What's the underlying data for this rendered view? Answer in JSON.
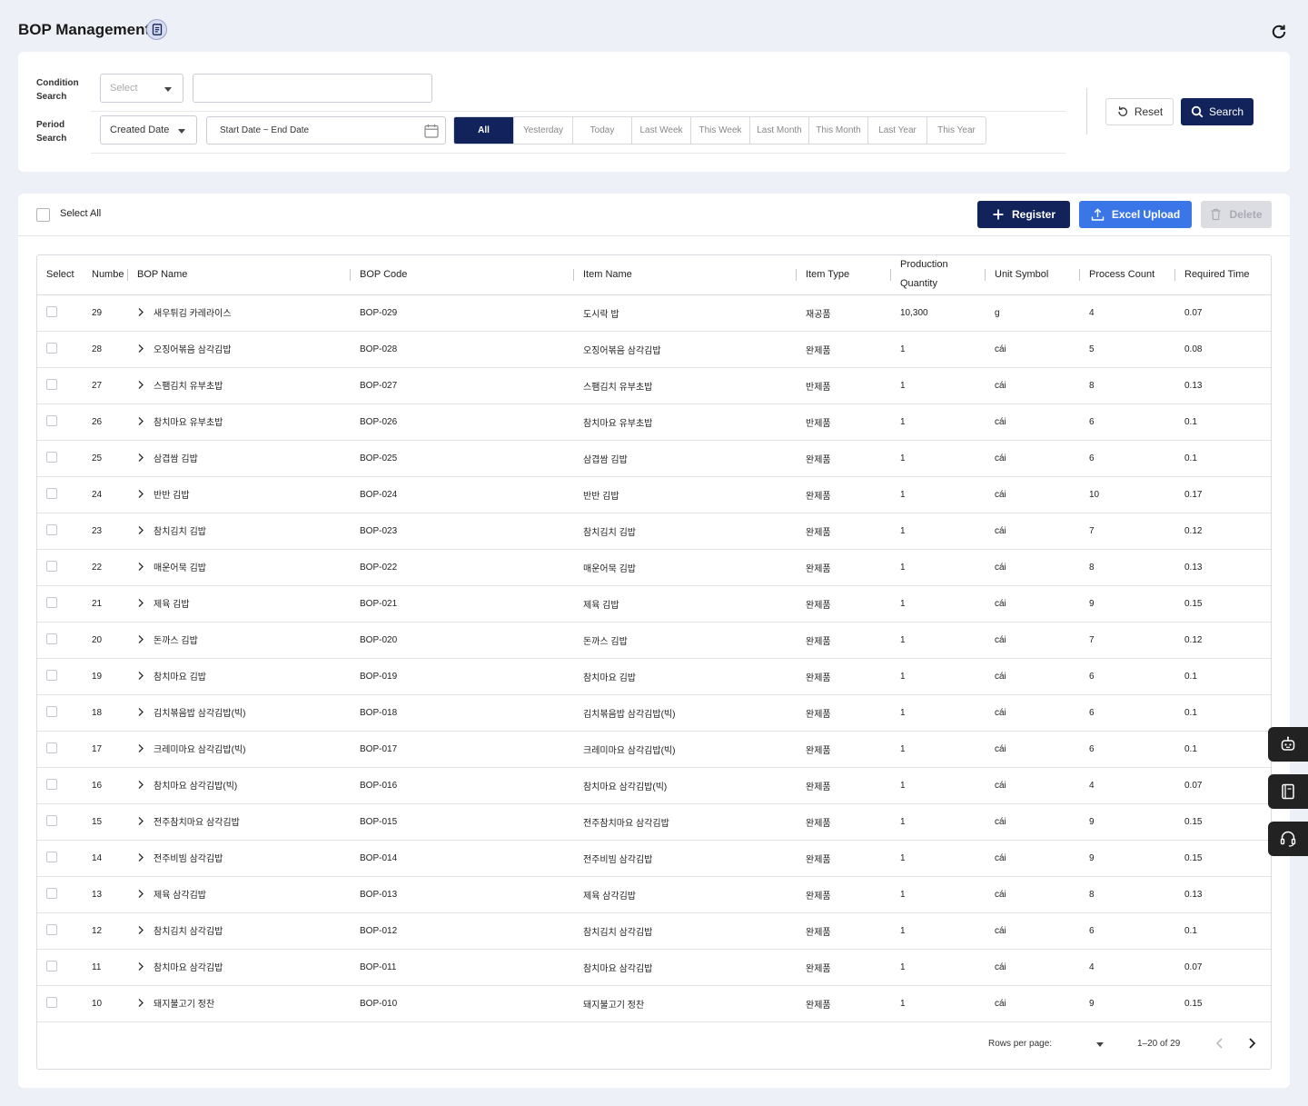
{
  "header": {
    "title": "BOP Management"
  },
  "filters": {
    "condition_label": "Condition Search",
    "condition_select": "Select",
    "period_label": "Period Search",
    "period_select": "Created Date",
    "date_range": "Start Date ~ End Date",
    "periods": [
      "All",
      "Yesterday",
      "Today",
      "Last Week",
      "This Week",
      "Last Month",
      "This Month",
      "Last Year",
      "This Year"
    ],
    "active_period": "All",
    "reset_label": "Reset",
    "search_label": "Search"
  },
  "toolbar": {
    "select_all": "Select All",
    "register": "Register",
    "excel_upload": "Excel Upload",
    "delete": "Delete"
  },
  "table": {
    "columns": [
      "Select",
      "Numbe",
      "BOP Name",
      "BOP Code",
      "Item Name",
      "Item Type",
      "Production Quantity",
      "Unit Symbol",
      "Process Count",
      "Required Time"
    ],
    "rows": [
      [
        "29",
        "새우튀김 카레라이스",
        "BOP-029",
        "도시락 밥",
        "재공품",
        "10,300",
        "g",
        "4",
        "0.07"
      ],
      [
        "28",
        "오징어볶음 삼각김밥",
        "BOP-028",
        "오징어볶음 삼각김밥",
        "완제품",
        "1",
        "cái",
        "5",
        "0.08"
      ],
      [
        "27",
        "스팸김치 유부초밥",
        "BOP-027",
        "스팸김치 유부초밥",
        "반제품",
        "1",
        "cái",
        "8",
        "0.13"
      ],
      [
        "26",
        "참치마요 유부초밥",
        "BOP-026",
        "참치마요 유부초밥",
        "반제품",
        "1",
        "cái",
        "6",
        "0.1"
      ],
      [
        "25",
        "삼겹쌈 김밥",
        "BOP-025",
        "삼겹쌈 김밥",
        "완제품",
        "1",
        "cái",
        "6",
        "0.1"
      ],
      [
        "24",
        "반반 김밥",
        "BOP-024",
        "반반 김밥",
        "완제품",
        "1",
        "cái",
        "10",
        "0.17"
      ],
      [
        "23",
        "참치김치 김밥",
        "BOP-023",
        "참치김치 김밥",
        "완제품",
        "1",
        "cái",
        "7",
        "0.12"
      ],
      [
        "22",
        "매운어묵 김밥",
        "BOP-022",
        "매운어묵 김밥",
        "완제품",
        "1",
        "cái",
        "8",
        "0.13"
      ],
      [
        "21",
        "제육 김밥",
        "BOP-021",
        "제육 김밥",
        "완제품",
        "1",
        "cái",
        "9",
        "0.15"
      ],
      [
        "20",
        "돈까스 김밥",
        "BOP-020",
        "돈까스 김밥",
        "완제품",
        "1",
        "cái",
        "7",
        "0.12"
      ],
      [
        "19",
        "참치마요 김밥",
        "BOP-019",
        "참치마요 김밥",
        "완제품",
        "1",
        "cái",
        "6",
        "0.1"
      ],
      [
        "18",
        "김치볶음밥 삼각김밥(빅)",
        "BOP-018",
        "김치볶음밥 삼각김밥(빅)",
        "완제품",
        "1",
        "cái",
        "6",
        "0.1"
      ],
      [
        "17",
        "크레미마요 삼각김밥(빅)",
        "BOP-017",
        "크레미마요 삼각김밥(빅)",
        "완제품",
        "1",
        "cái",
        "6",
        "0.1"
      ],
      [
        "16",
        "참치마요 삼각김밥(빅)",
        "BOP-016",
        "참치마요 삼각김밥(빅)",
        "완제품",
        "1",
        "cái",
        "4",
        "0.07"
      ],
      [
        "15",
        "전주참치마요 삼각김밥",
        "BOP-015",
        "전주참치마요 삼각김밥",
        "완제품",
        "1",
        "cái",
        "9",
        "0.15"
      ],
      [
        "14",
        "전주비빔 삼각김밥",
        "BOP-014",
        "전주비빔 삼각김밥",
        "완제품",
        "1",
        "cái",
        "9",
        "0.15"
      ],
      [
        "13",
        "제육 삼각김밥",
        "BOP-013",
        "제육 삼각김밥",
        "완제품",
        "1",
        "cái",
        "8",
        "0.13"
      ],
      [
        "12",
        "참치김치 삼각김밥",
        "BOP-012",
        "참치김치 삼각김밥",
        "완제품",
        "1",
        "cái",
        "6",
        "0.1"
      ],
      [
        "11",
        "참치마요 삼각김밥",
        "BOP-011",
        "참치마요 삼각김밥",
        "완제품",
        "1",
        "cái",
        "4",
        "0.07"
      ],
      [
        "10",
        "돼지불고기 정찬",
        "BOP-010",
        "돼지불고기 정찬",
        "완제품",
        "1",
        "cái",
        "9",
        "0.15"
      ]
    ]
  },
  "pagination": {
    "rows_per_page_label": "Rows per page:",
    "range": "1–20 of 29"
  },
  "floating_buttons": [
    "robot-icon",
    "book-icon",
    "headset-icon"
  ],
  "colors": {
    "primary": "#11235a",
    "accent": "#3b76e8",
    "page_bg": "#eef0f7"
  }
}
